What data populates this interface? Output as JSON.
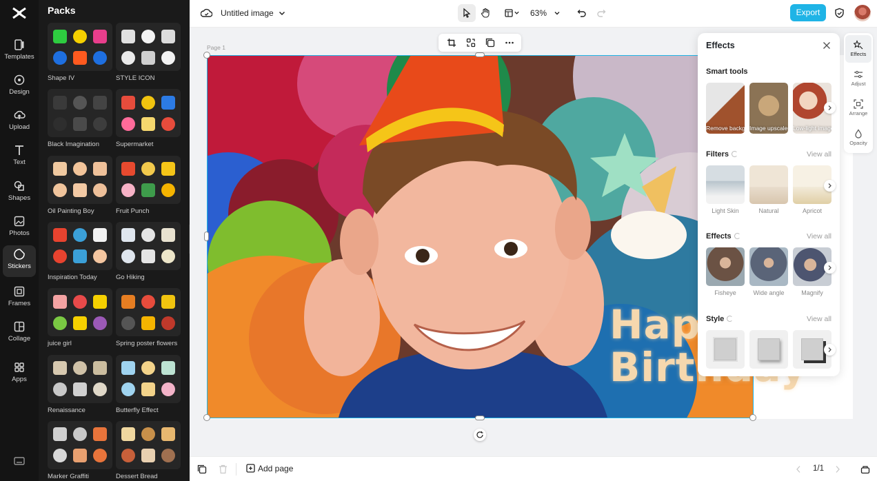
{
  "left_rail": {
    "items": [
      {
        "label": "Templates",
        "icon": "templates-icon"
      },
      {
        "label": "Design",
        "icon": "design-icon"
      },
      {
        "label": "Upload",
        "icon": "upload-icon"
      },
      {
        "label": "Text",
        "icon": "text-icon"
      },
      {
        "label": "Shapes",
        "icon": "shapes-icon"
      },
      {
        "label": "Photos",
        "icon": "photos-icon"
      },
      {
        "label": "Stickers",
        "icon": "stickers-icon"
      },
      {
        "label": "Frames",
        "icon": "frames-icon"
      },
      {
        "label": "Collage",
        "icon": "collage-icon"
      },
      {
        "label": "Apps",
        "icon": "apps-icon"
      }
    ],
    "active": "Stickers"
  },
  "packs": {
    "title": "Packs",
    "items": [
      {
        "name": "Shape IV",
        "colors": [
          "#2ecc40",
          "#f5d000",
          "#e83e8c",
          "#1e6fe0",
          "#ff5a1f",
          "#1e6fe0"
        ]
      },
      {
        "name": "STYLE ICON",
        "colors": [
          "#e0e0e0",
          "#f4f4f4",
          "#dcdcdc",
          "#eaeaea",
          "#cfcfcf",
          "#f2f2f2"
        ]
      },
      {
        "name": "Black Imagination",
        "colors": [
          "#3a3a3a",
          "#555555",
          "#444444",
          "#2e2e2e",
          "#4a4a4a",
          "#3d3d3d"
        ]
      },
      {
        "name": "Supermarket",
        "colors": [
          "#e74c3c",
          "#f1c40f",
          "#2c7be5",
          "#ff6b9a",
          "#f5d76e",
          "#e74c3c"
        ]
      },
      {
        "name": "Oil Painting Boy",
        "colors": [
          "#f0c9a0",
          "#f2c49a",
          "#efc19a",
          "#f0c49c",
          "#f3c9a4",
          "#eec09a"
        ]
      },
      {
        "name": "Fruit Punch",
        "colors": [
          "#e84a2f",
          "#f2c94c",
          "#f5c518",
          "#f7b2c6",
          "#3e9c4b",
          "#f5b400"
        ]
      },
      {
        "name": "Inspiration Today",
        "colors": [
          "#e8432f",
          "#3ba0d8",
          "#f2f2f2",
          "#e8432f",
          "#3ba0d8",
          "#f4c6a0"
        ]
      },
      {
        "name": "Go Hiking",
        "colors": [
          "#dfe6ee",
          "#e4e4e4",
          "#e8e2d0",
          "#dfe6ee",
          "#e4e4e4",
          "#ede6c9"
        ]
      },
      {
        "name": "juice girl",
        "colors": [
          "#f4a3a3",
          "#e84a4a",
          "#f5d000",
          "#7ac943",
          "#f5d000",
          "#9b59b6"
        ]
      },
      {
        "name": "Spring poster flowers",
        "colors": [
          "#e67e22",
          "#e74c3c",
          "#f1c40f",
          "#555555",
          "#f5b400",
          "#c0392b"
        ]
      },
      {
        "name": "Renaissance",
        "colors": [
          "#d7c9b0",
          "#d0c2a8",
          "#cbbd9f",
          "#c8c8c8",
          "#d0d0d0",
          "#e0d8c8"
        ]
      },
      {
        "name": "Butterfly Effect",
        "colors": [
          "#9fd3ef",
          "#f3d38a",
          "#bde3d2",
          "#9fd3ef",
          "#f3d38a",
          "#f3b3c8"
        ]
      },
      {
        "name": "Marker Graffiti",
        "colors": [
          "#d0d0d0",
          "#c8c8c8",
          "#e8743b",
          "#d8d8d8",
          "#e8a070",
          "#e8743b"
        ]
      },
      {
        "name": "Dessert Bread",
        "colors": [
          "#f0d8a0",
          "#c8904a",
          "#e8b870",
          "#c8603a",
          "#e8d0b0",
          "#a07050"
        ]
      }
    ]
  },
  "topbar": {
    "title": "Untitled image",
    "zoom": "63%",
    "export_label": "Export"
  },
  "canvas": {
    "page_label": "Page 1",
    "overlay_text": "Happy\nBirthday"
  },
  "effects_panel": {
    "title": "Effects",
    "smart_tools": {
      "title": "Smart tools",
      "items": [
        {
          "label": "Remove background",
          "color": "#a0522d"
        },
        {
          "label": "Image upscaler",
          "color": "#8b7355"
        },
        {
          "label": "Low-light image...",
          "color": "#b0462f"
        }
      ]
    },
    "filters": {
      "title": "Filters",
      "view_all": "View all",
      "items": [
        {
          "label": "Light Skin",
          "color": "#b8c4cc"
        },
        {
          "label": "Natural",
          "color": "#e8dccc"
        },
        {
          "label": "Apricot",
          "color": "#f2ead8"
        }
      ]
    },
    "effects": {
      "title": "Effects",
      "view_all": "View all",
      "items": [
        {
          "label": "Fisheye",
          "color": "#6b5244"
        },
        {
          "label": "Wide angle",
          "color": "#5a6478"
        },
        {
          "label": "Magnify",
          "color": "#4d5570"
        }
      ]
    },
    "style": {
      "title": "Style",
      "view_all": "View all"
    }
  },
  "right_rail": {
    "items": [
      {
        "label": "Effects",
        "icon": "effects-icon"
      },
      {
        "label": "Adjust",
        "icon": "adjust-icon"
      },
      {
        "label": "Arrange",
        "icon": "arrange-icon"
      },
      {
        "label": "Opacity",
        "icon": "opacity-icon"
      }
    ],
    "active": "Effects"
  },
  "bottombar": {
    "add_page_label": "Add page",
    "page_indicator": "1/1"
  }
}
